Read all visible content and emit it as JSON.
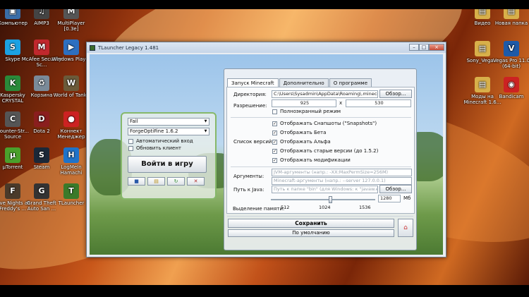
{
  "desktop": {
    "icons_left": [
      {
        "label": "Компьютер",
        "glyph": "▣",
        "color": "#3a6ea8",
        "icon": "computer-icon"
      },
      {
        "label": "AIMP3",
        "glyph": "♫",
        "color": "#444",
        "icon": "aimp-icon"
      },
      {
        "label": "MultiPlayer [0.3e]",
        "glyph": "M",
        "color": "#555",
        "icon": "multiplayer-icon"
      },
      {
        "label": "Skype",
        "glyph": "S",
        "color": "#1ba1e2",
        "icon": "skype-icon"
      },
      {
        "label": "McAfee Security Sc...",
        "glyph": "M",
        "color": "#c0282d",
        "icon": "mcafee-icon"
      },
      {
        "label": "Windows Player",
        "glyph": "▶",
        "color": "#2d6fc0",
        "icon": "windows-player-icon"
      },
      {
        "label": "Kaspersky CRYSTAL",
        "glyph": "K",
        "color": "#2a8a3a",
        "icon": "kaspersky-icon"
      },
      {
        "label": "Корзина",
        "glyph": "♻",
        "color": "#7a8a99",
        "icon": "recycle-bin-icon"
      },
      {
        "label": "World of Tanks",
        "glyph": "W",
        "color": "#6b5a3a",
        "icon": "world-of-tanks-icon"
      },
      {
        "label": "Counter-Str... Source",
        "glyph": "C",
        "color": "#555",
        "icon": "counter-strike-icon"
      },
      {
        "label": "Dota 2",
        "glyph": "D",
        "color": "#8a1e1e",
        "icon": "dota2-icon"
      },
      {
        "label": "Коннект Менеджер",
        "glyph": "●",
        "color": "#c22",
        "icon": "connect-manager-icon"
      },
      {
        "label": "µTorrent",
        "glyph": "µ",
        "color": "#4aa02c",
        "icon": "utorrent-icon"
      },
      {
        "label": "Steam",
        "glyph": "S",
        "color": "#1b2838",
        "icon": "steam-icon"
      },
      {
        "label": "LogMeIn Hamachi",
        "glyph": "H",
        "color": "#1f73c9",
        "icon": "hamachi-icon"
      },
      {
        "label": "Five Nights at Freddy's ...",
        "glyph": "F",
        "color": "#4a3a2a",
        "icon": "fnaf-icon"
      },
      {
        "label": "Grand Theft Auto San ...",
        "glyph": "G",
        "color": "#333",
        "icon": "gta-icon"
      },
      {
        "label": "TLauncher",
        "glyph": "T",
        "color": "#3b7a2a",
        "icon": "tlauncher-icon"
      }
    ],
    "icons_right": [
      {
        "label": "Видео",
        "glyph": "▤",
        "color": "#d8b04a",
        "icon": "folder-icon"
      },
      {
        "label": "Новая папка",
        "glyph": "▤",
        "color": "#d8b04a",
        "icon": "folder-icon"
      },
      {
        "label": "Sony_Vega...",
        "glyph": "▤",
        "color": "#d8b04a",
        "icon": "folder-icon"
      },
      {
        "label": "Vegas Pro 11.0 (64-bit)",
        "glyph": "V",
        "color": "#1e5aa8",
        "icon": "vegas-icon"
      },
      {
        "label": "Моды на Minecraft 1.6...",
        "glyph": "▤",
        "color": "#d8b04a",
        "icon": "folder-icon"
      },
      {
        "label": "Bandicam",
        "glyph": "◉",
        "color": "#c22",
        "icon": "bandicam-icon"
      }
    ]
  },
  "window": {
    "title": "TLauncher Legacy 1.481",
    "controls": {
      "minimize": "–",
      "maximize": "□",
      "close": "×"
    }
  },
  "login": {
    "username": "Fail",
    "version": "ForgeOptiFine 1.6.2",
    "auto_login_label": "Автоматический вход",
    "update_client_label": "Обновить клиент",
    "play_label": "Войти в игру",
    "small_buttons": [
      "■",
      "▤",
      "↻",
      "✕"
    ]
  },
  "settings": {
    "tabs": [
      "Запуск Minecraft",
      "Дополнительно",
      "О программе"
    ],
    "directory_label": "Директория:",
    "directory_value": "C:\\Users\\Sysadmin\\AppData\\Roaming\\.minecraft",
    "browse_label": "Обзор...",
    "resolution_label": "Разрешение:",
    "width": "925",
    "x_sep": "x",
    "height": "530",
    "fullscreen_label": "Полноэкранный режим",
    "version_list_label": "Список версий:",
    "options": [
      "Отображать Снапшоты (\"Snapshots\")",
      "Отображать Бета",
      "Отображать Альфа",
      "Отображать старые версии (до 1.5.2)",
      "Отображать модификации"
    ],
    "arguments_label": "Аргументы:",
    "jvm_placeholder": "JVM-аргументы (напр.: -XX:MaxPermSize=256M)",
    "mc_placeholder": "Minecraft-аргументы (напр.: --server 127.0.0.1)",
    "java_label": "Путь к Java:",
    "java_placeholder": "Путь к папке \"bin\" (для Windows: к \"javaw.exe\")",
    "memory_label": "Выделение памяти:",
    "memory_value": "1280",
    "memory_unit": "Мб",
    "memory_fraction": 0.57,
    "ticks": [
      "512",
      "1024",
      "1536"
    ],
    "save_label": "Сохранить",
    "default_label": "По умолчанию",
    "home_glyph": "⌂"
  }
}
